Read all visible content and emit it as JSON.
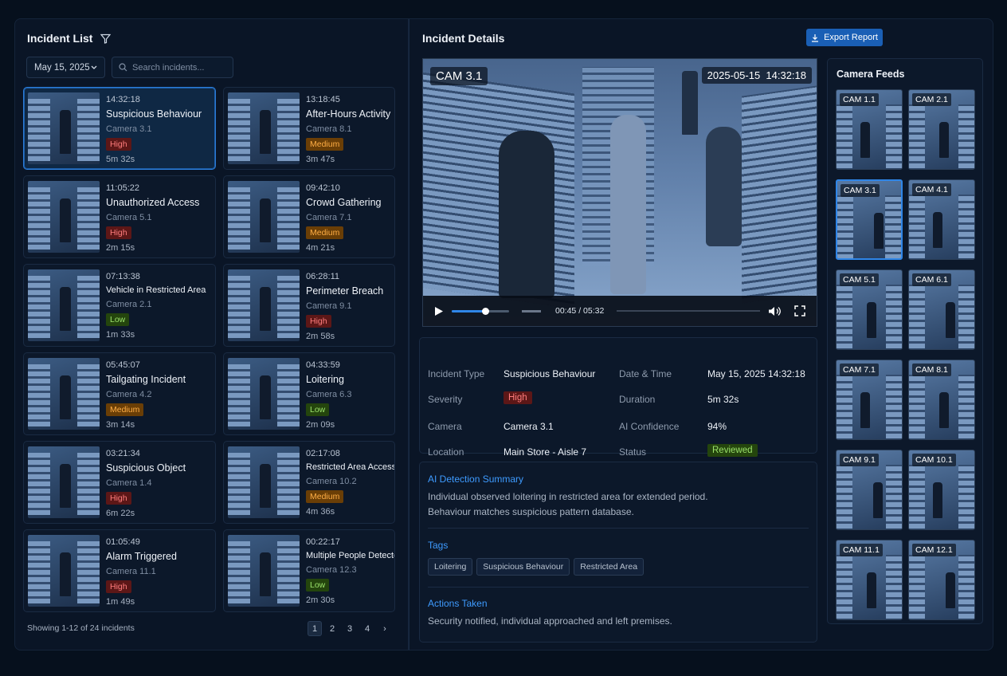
{
  "incident_list": {
    "title": "Incident List",
    "date_filter": "May 15, 2025",
    "search_placeholder": "Search incidents...",
    "incidents": [
      {
        "time": "14:32:18",
        "name": "Suspicious Behaviour",
        "camera": "Camera 3.1",
        "severity": "High",
        "duration": "5m 32s"
      },
      {
        "time": "13:18:45",
        "name": "After-Hours Activity",
        "camera": "Camera 8.1",
        "severity": "Medium",
        "duration": "3m 47s"
      },
      {
        "time": "11:05:22",
        "name": "Unauthorized Access",
        "camera": "Camera 5.1",
        "severity": "High",
        "duration": "2m 15s"
      },
      {
        "time": "09:42:10",
        "name": "Crowd Gathering",
        "camera": "Camera 7.1",
        "severity": "Medium",
        "duration": "4m 21s"
      },
      {
        "time": "07:13:38",
        "name": "Vehicle in Restricted Area",
        "camera": "Camera 2.1",
        "severity": "Low",
        "duration": "1m 33s"
      },
      {
        "time": "06:28:11",
        "name": "Perimeter Breach",
        "camera": "Camera 9.1",
        "severity": "High",
        "duration": "2m 58s"
      },
      {
        "time": "05:45:07",
        "name": "Tailgating Incident",
        "camera": "Camera 4.2",
        "severity": "Medium",
        "duration": "3m 14s"
      },
      {
        "time": "04:33:59",
        "name": "Loitering",
        "camera": "Camera 6.3",
        "severity": "Low",
        "duration": "2m 09s"
      },
      {
        "time": "03:21:34",
        "name": "Suspicious Object",
        "camera": "Camera 1.4",
        "severity": "High",
        "duration": "6m 22s"
      },
      {
        "time": "02:17:08",
        "name": "Restricted Area Access",
        "camera": "Camera 10.2",
        "severity": "Medium",
        "duration": "4m 36s"
      },
      {
        "time": "01:05:49",
        "name": "Alarm Triggered",
        "camera": "Camera 11.1",
        "severity": "High",
        "duration": "1m 49s"
      },
      {
        "time": "00:22:17",
        "name": "Multiple People Detected",
        "camera": "Camera 12.3",
        "severity": "Low",
        "duration": "2m 30s"
      }
    ],
    "footer": "Showing 1-12 of 24 incidents",
    "pages": [
      "1",
      "2",
      "3",
      "4"
    ]
  },
  "details": {
    "title": "Incident Details",
    "export_label": "Export Report",
    "video": {
      "camera_label": "CAM 3.1",
      "timestamp": "2025-05-15  14:32:18",
      "time": "00:45 / 05:32",
      "progress": 0.14
    },
    "labels": {
      "type": "Incident Type",
      "severity": "Severity",
      "camera": "Camera",
      "location": "Location",
      "datetime": "Date & Time",
      "duration": "Duration",
      "confidence": "AI Confidence",
      "status": "Status"
    },
    "values": {
      "type": "Suspicious Behaviour",
      "severity": "High",
      "camera": "Camera 3.1",
      "location": "Main Store - Aisle 7",
      "datetime": "May 15, 2025 14:32:18",
      "duration": "5m 32s",
      "confidence": "94%",
      "status": "Reviewed"
    },
    "ai_title": "AI Detection Summary",
    "ai_text_1": "Individual observed loitering in restricted area for extended period.",
    "ai_text_2": "Behaviour matches suspicious pattern database.",
    "tags_title": "Tags",
    "tags": [
      "Loitering",
      "Suspicious Behaviour",
      "Restricted Area"
    ],
    "actions_title": "Actions Taken",
    "actions_text": "Security notified, individual approached and left premises."
  },
  "feeds": {
    "title": "Camera Feeds",
    "cams": [
      "CAM 1.1",
      "CAM 2.1",
      "CAM 3.1",
      "CAM 4.1",
      "CAM 5.1",
      "CAM 6.1",
      "CAM 7.1",
      "CAM 8.1",
      "CAM 9.1",
      "CAM 10.1",
      "CAM 11.1",
      "CAM 12.1"
    ]
  }
}
